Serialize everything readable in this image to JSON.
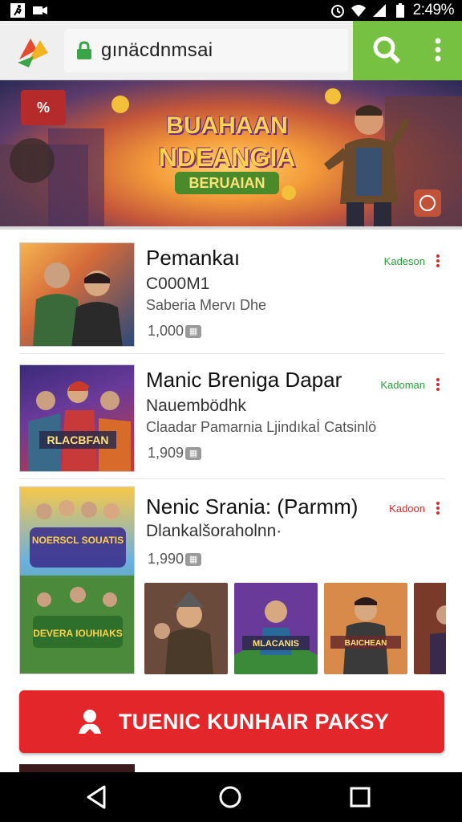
{
  "status_bar": {
    "time": "2:49%",
    "icons": [
      "running-icon",
      "video-icon",
      "alarm-icon",
      "wifi-icon",
      "signal-icon",
      "battery-icon"
    ]
  },
  "browser": {
    "url": "gınäcdnmsai",
    "icons": [
      "app-logo",
      "lock-icon",
      "search-icon",
      "more-vert-icon"
    ],
    "accent": "#76c141"
  },
  "banner": {
    "badge": "%",
    "title": "BUAHAAN",
    "subtitle": "NDEANGIA",
    "tag": "BERUAIAN"
  },
  "games": [
    {
      "title": "Pemankaı",
      "sub1": "C000M1",
      "sub2": "Saberia Mervı Dhe",
      "count": "1,000",
      "tag": "Kadeson",
      "tag_color": "#2a9d3a"
    },
    {
      "title": "Manic Brenigа Dapar",
      "sub1": "Nauembödhk",
      "sub2": "Claadar Pamarnia Ljindıkaİ Catsinlö",
      "count": "1,909",
      "tag": "Kadoman",
      "tag_color": "#2a9d3a",
      "thumb_label": "RLACBFAN"
    },
    {
      "title": "Nenic Srania: (Parmm)",
      "sub1": "Dlankalšoraholnn·",
      "count": "1,990",
      "tag": "Kadoon",
      "tag_color": "#d32a2a",
      "thumb_label_top": "NOERSCL SOUATIS",
      "thumb_label_bottom": "DEVERA IOUHIAKS"
    }
  ],
  "screenshot_labels": [
    "MLACANIS",
    "BAICHEAN"
  ],
  "cta": {
    "label": "TUENIC KUNHAIR PAKSY",
    "color": "#e3262a"
  },
  "nav": {
    "icons": [
      "back-icon",
      "home-icon",
      "recents-icon"
    ]
  }
}
